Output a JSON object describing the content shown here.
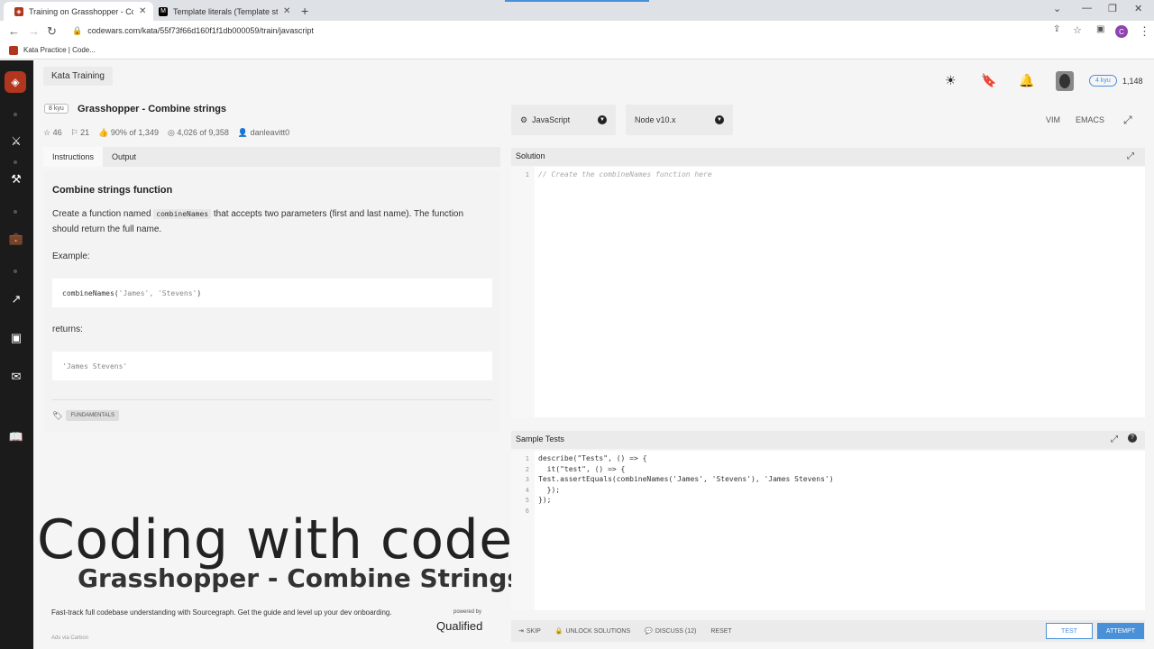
{
  "browser": {
    "tabs": [
      {
        "title": "Training on Grasshopper - Combine strings",
        "favicon": "codewars-icon"
      },
      {
        "title": "Template literals (Template strings) - JavaScript",
        "favicon": "mdn-icon"
      }
    ],
    "url": "codewars.com/kata/55f73f66d160f1f1db000059/train/javascript",
    "bookmark": "Kata Practice | Code...",
    "profile_initial": "C"
  },
  "header": {
    "kata_training": "Kata Training",
    "rank": "8 kyu",
    "title": "Grasshopper - Combine strings",
    "stats": {
      "stars": "46",
      "collections": "21",
      "satisfaction": "90% of 1,349",
      "completed": "4,026 of 9,358",
      "author": "danleavitt0"
    },
    "user_kyu": "4 kyu",
    "honor": "1,148"
  },
  "subtabs": {
    "instructions": "Instructions",
    "output": "Output"
  },
  "description": {
    "heading": "Combine strings function",
    "p1_pre": "Create a function named ",
    "p1_code": "combineNames",
    "p1_post": " that accepts two parameters (first and last name). The function should return the full name.",
    "example_label": "Example:",
    "example_fn": "combineNames(",
    "example_args": "'James', 'Stevens'",
    "example_close": ")",
    "returns_label": "returns:",
    "returns_value": "'James Stevens'",
    "tag": "FUNDAMENTALS"
  },
  "overlay": {
    "big": "Coding with codeManS",
    "sub": "Grasshopper - Combine Strings"
  },
  "carbon": {
    "text": "Fast-track full codebase understanding with Sourcegraph. Get the guide and level up your dev onboarding.",
    "via": "Ads via Carbon",
    "powered": "powered by",
    "brand": "Qualified"
  },
  "editor": {
    "language": "JavaScript",
    "runtime": "Node v10.x",
    "vim": "VIM",
    "emacs": "EMACS",
    "solution_label": "Solution",
    "solution_code": "// Create the combineNames function here",
    "tests_label": "Sample Tests",
    "tests_lines": [
      "describe(\"Tests\", () => {",
      "  it(\"test\", () => {",
      "Test.assertEquals(combineNames('James', 'Stevens'), 'James Stevens')",
      "  });",
      "});",
      ""
    ]
  },
  "actions": {
    "skip": "SKIP",
    "unlock": "UNLOCK SOLUTIONS",
    "discuss": "DISCUSS (12)",
    "reset": "RESET",
    "test": "TEST",
    "attempt": "ATTEMPT"
  }
}
